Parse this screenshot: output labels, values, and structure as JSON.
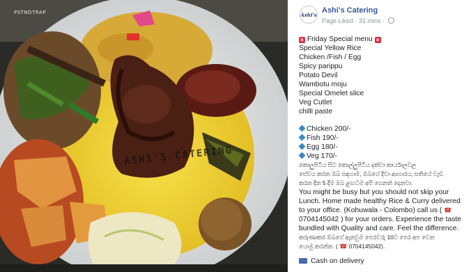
{
  "photo": {
    "watermark_top": "PSTNDTRAP",
    "watermark_center": "ASHI'S CATERING"
  },
  "post": {
    "page_name": "Ashi's Catering",
    "avatar_text": "Ashi's",
    "meta": "Page Liked · 31 mins ·",
    "title": "Friday Special menu",
    "menu_items": [
      "Special Yellow Rice",
      "Chicken /Fish / Egg",
      "Spicy parippu",
      "Potato Devil",
      "Wambotu moju",
      "Special Omelet slice",
      "Veg Cutlet",
      "chilli paste"
    ],
    "prices": [
      "Chicken 200/-",
      "Fish 190/-",
      "Egg 180/-",
      "Veg 170/-"
    ],
    "sinhala_line_1": "කොලුපිටිය සිට කොල්ලුපිටිය දක්වා කාර්යාලවල",
    "sinhala_line_2": "සේවය කරන ඔබ සඳහාම, ඔබගේ දිවා ආහාරය, සතියේ වැඩ",
    "sinhala_line_3": "කරන දින 5 දීම ඔබ ළඟටම අපි ගෙනත් දෙනවා.",
    "english_para_1": "You might be busy but you should not skip your",
    "english_para_2": "Lunch. Home made healthy Rice & Curry delivered",
    "english_para_3": "to your office. (Kohuwala - Colombo) call us (",
    "phone_icon": "☎",
    "english_para_4": "0704145042 ) for your orders. Experience the taste",
    "english_para_5": "bundled with Quality and care. Feel the difference.",
    "sinhala_line_4": "කරුණාකර ඔබගේ ඇනවුම පෙරවරු 10ට පෙර අප වෙත",
    "sinhala_line_5": "යොමු කරන්න. (",
    "sinhala_line_5b": "0704145042).",
    "cash": "Cash on delivery"
  },
  "colors": {
    "link_blue": "#385898",
    "meta_gray": "#8d949e",
    "red_x": "#dd2e44",
    "diamond_blue": "#3b88c3"
  }
}
